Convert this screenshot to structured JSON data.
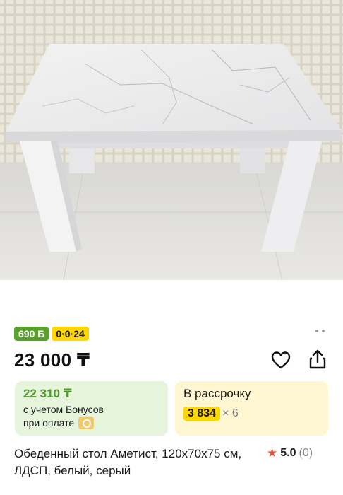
{
  "product": {
    "bonus_badge": "690 Б",
    "installment_badge": "0·0·24",
    "price": "23 000 ₸",
    "bonus_card": {
      "amount": "22 310 ₸",
      "line1": "с учетом Бонусов",
      "line2": "при оплате"
    },
    "installment_card": {
      "title": "В рассрочку",
      "monthly": "3 834",
      "multiplier": "× 6"
    },
    "name": "Обеденный стол Аметист, 120x70x75 см, ЛДСП, белый, серый",
    "rating": {
      "score": "5.0",
      "count": "(0)"
    }
  },
  "icons": {
    "favorite": "heart-icon",
    "share": "share-icon",
    "more": "more-dots-icon",
    "rating_star": "star-icon",
    "payment": "kaspi-icon"
  },
  "colors": {
    "bonus_green": "#5aa02c",
    "installment_yellow": "#ffd700",
    "star_red": "#e2533c"
  }
}
